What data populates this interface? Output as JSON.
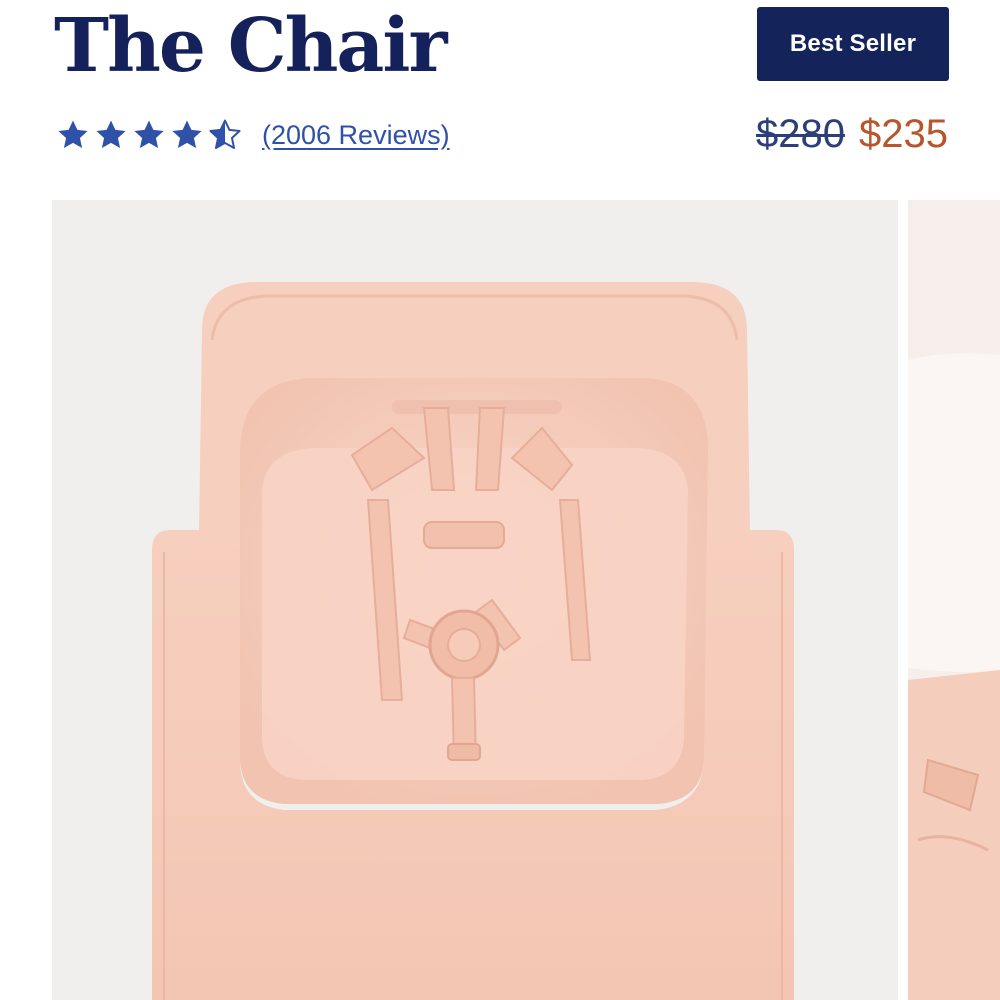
{
  "product": {
    "title": "The Chair",
    "badge": "Best Seller",
    "rating": 4.5,
    "rating_max": 5,
    "reviews_label": "(2006 Reviews)",
    "price_original": "$280",
    "price_sale": "$235"
  },
  "gallery": {
    "images": [
      {
        "subject": "pink high chair seat with tray and harness, top view"
      },
      {
        "subject": "partially visible next gallery image"
      }
    ]
  },
  "colors": {
    "navy": "#14215a",
    "star_blue": "#2f51a8",
    "sale_orange": "#b8552c",
    "chair_pink": "#f3c9b7"
  },
  "icons": [
    "star-icon",
    "half-star-icon"
  ]
}
